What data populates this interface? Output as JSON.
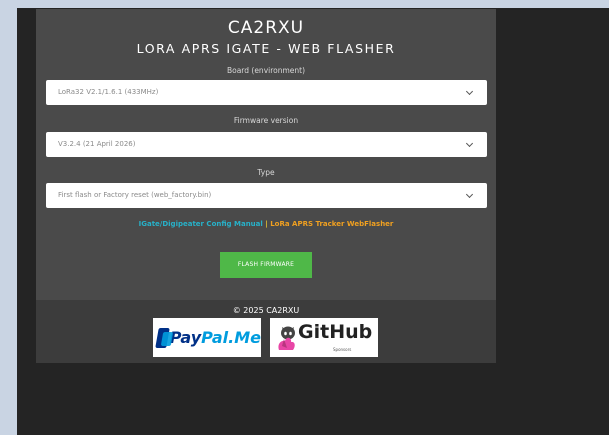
{
  "header": {
    "title": "CA2RXU",
    "subtitle": "LORA APRS IGATE - WEB FLASHER"
  },
  "board": {
    "label": "Board (environment)",
    "selected": "LoRa32 V2.1/1.6.1 (433MHz)"
  },
  "firmware": {
    "label": "Firmware version",
    "selected": "V3.2.4 (21 April 2026)"
  },
  "type": {
    "label": "Type",
    "selected": "First flash or Factory reset (web_factory.bin)"
  },
  "links": {
    "manual": "IGate/Digipeater Config Manual",
    "separator": "|",
    "tracker": "LoRa APRS Tracker WebFlasher"
  },
  "actions": {
    "flash_label": "FLASH FIRMWARE"
  },
  "footer": {
    "copyright": "© 2025 CA2RXU",
    "paypal_pay": "Pay",
    "paypal_pal": "Pal.Me",
    "github_text": "GitHub",
    "github_sub": "Sponsors"
  },
  "colors": {
    "card": "#4a4a4a",
    "footer": "#3c3c3c",
    "flash_button": "#4fb848",
    "link_manual": "#27b1c9",
    "link_tracker": "#f0a020"
  }
}
